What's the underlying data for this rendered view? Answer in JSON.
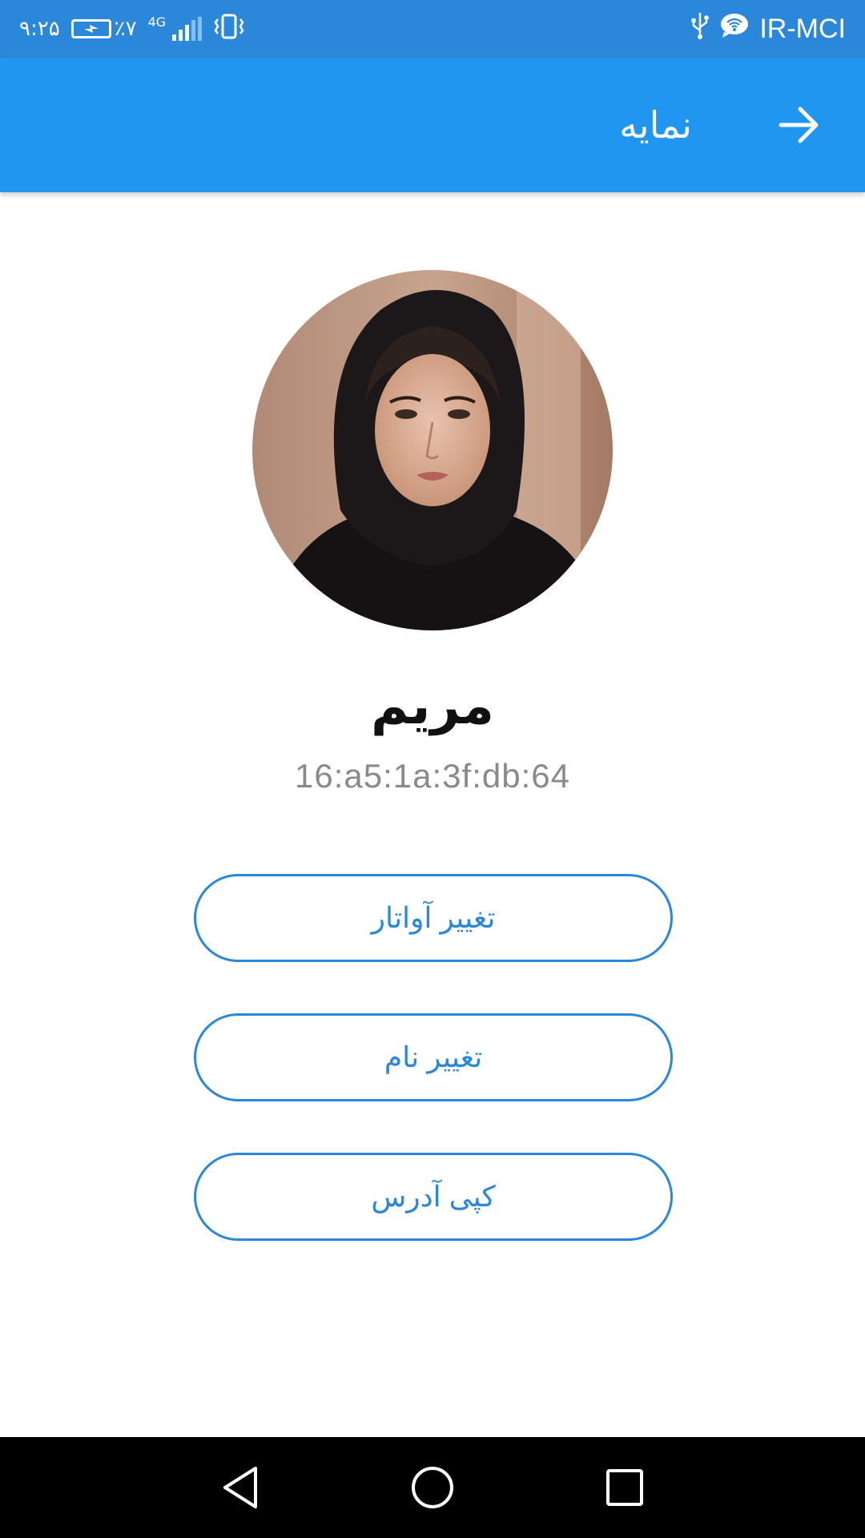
{
  "status_bar": {
    "time": "۹:۲۵",
    "battery": "٪۷",
    "network": "4G",
    "carrier": "IR-MCI",
    "icons": [
      "battery-charging-icon",
      "signal-icon",
      "vibrate-icon",
      "usb-icon",
      "wifi-calling-icon"
    ]
  },
  "app_bar": {
    "title": "نمایه",
    "back_icon": "arrow-right-icon"
  },
  "profile": {
    "name": "مریم",
    "address": "16:a5:1a:3f:db:64"
  },
  "buttons": {
    "change_avatar": "تغییر آواتار",
    "change_name": "تغییر نام",
    "copy_address": "کپی آدرس"
  },
  "colors": {
    "status_bar": "#2b87da",
    "app_bar": "#2196f0",
    "accent": "#2b87da",
    "address_text": "#8a8a8a",
    "nav_bar": "#000000"
  }
}
